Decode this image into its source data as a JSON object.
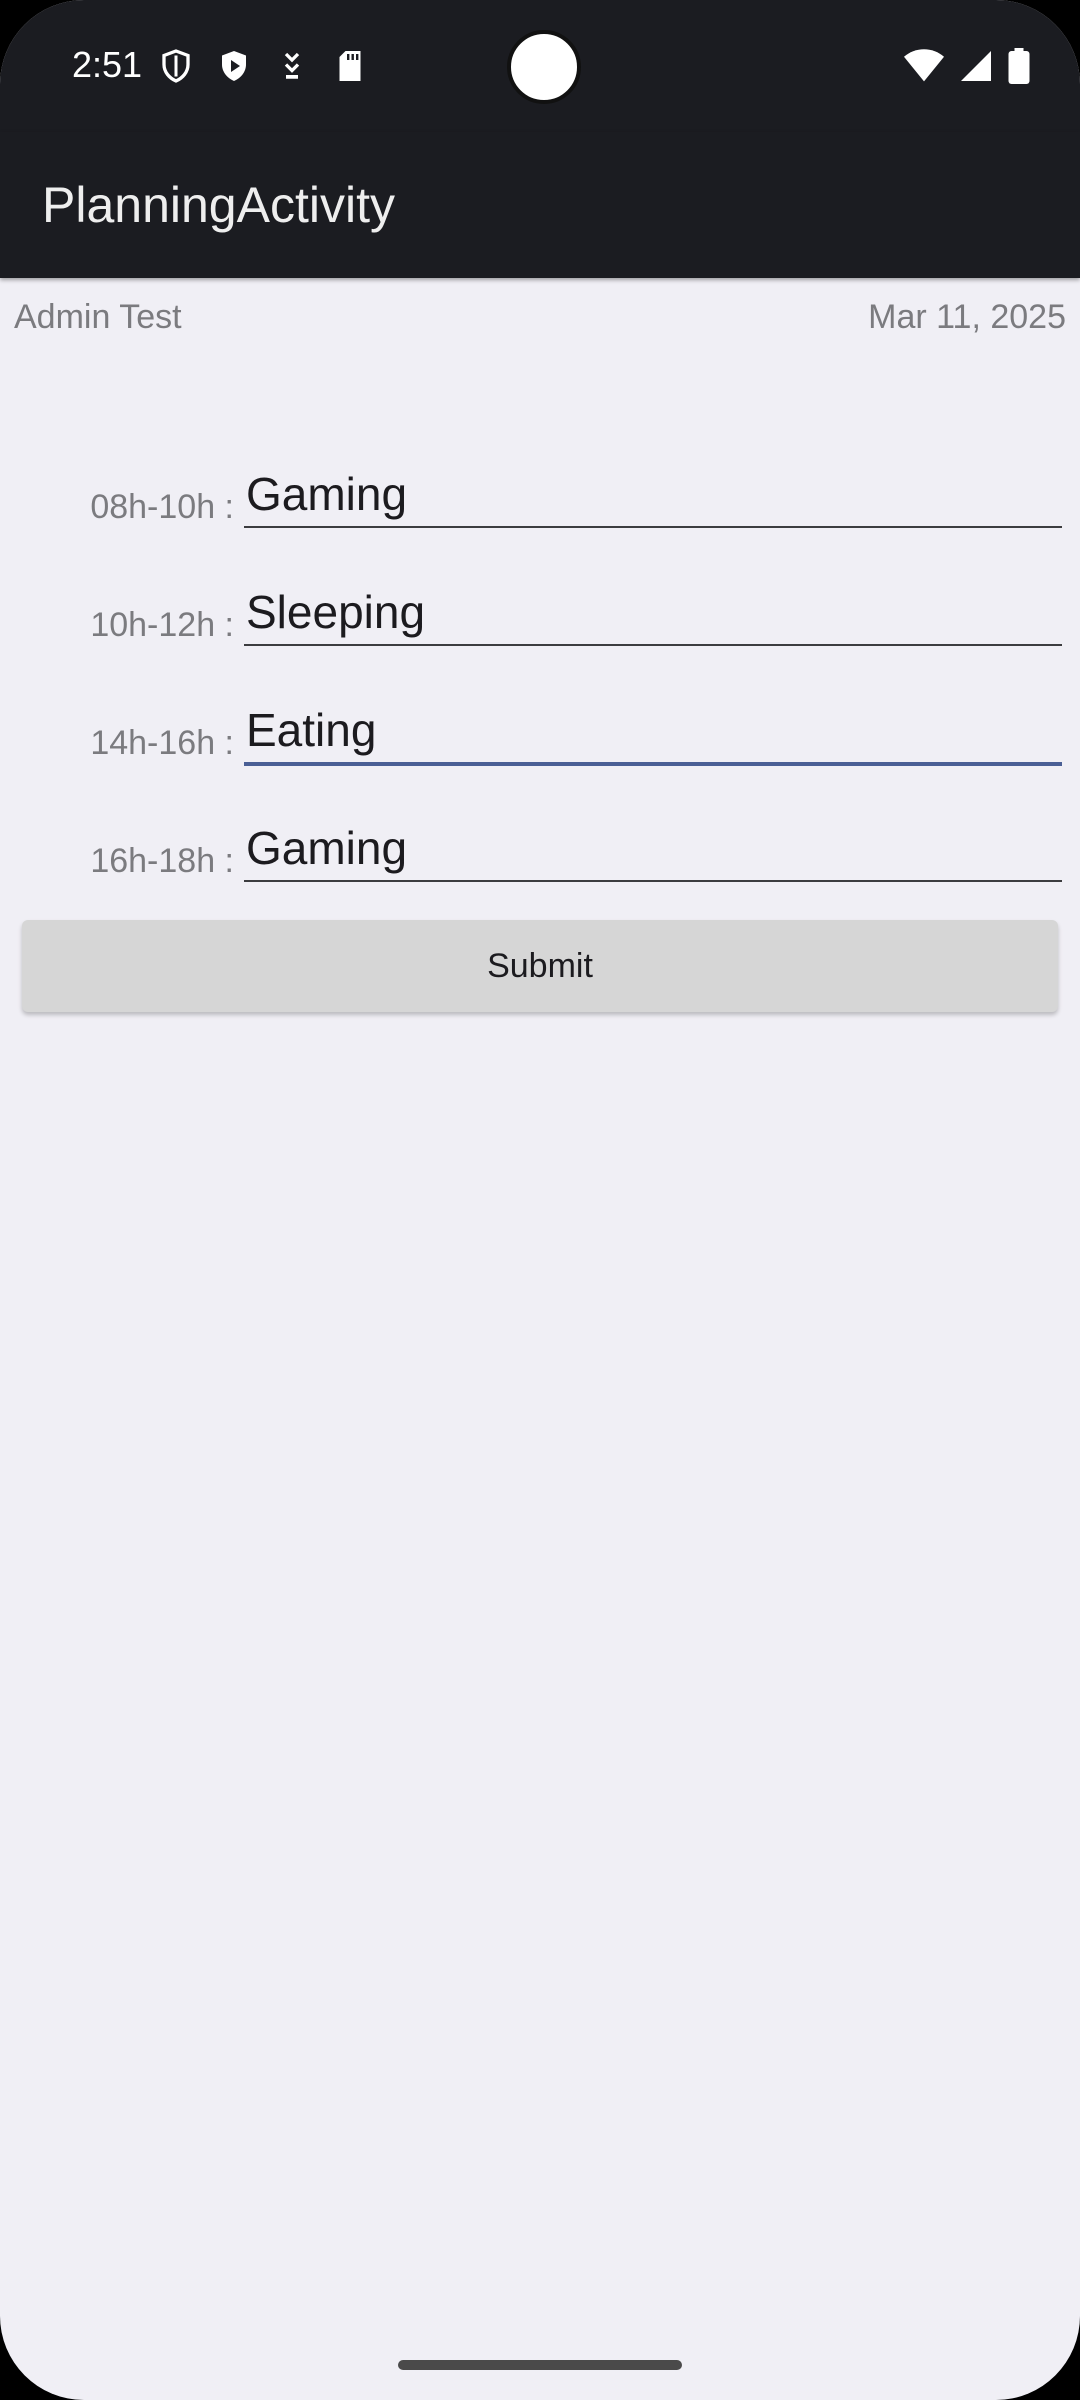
{
  "status_bar": {
    "time": "2:51",
    "icons_left": [
      "shield-icon",
      "play-protect-icon",
      "download-icon",
      "sd-card-icon"
    ],
    "icons_right": [
      "wifi-icon",
      "cell-signal-icon",
      "battery-icon"
    ]
  },
  "app_bar": {
    "title": "PlanningActivity"
  },
  "meta": {
    "user": "Admin Test",
    "date": "Mar 11, 2025"
  },
  "plan": {
    "rows": [
      {
        "label": "08h-10h :",
        "value": "Gaming"
      },
      {
        "label": "10h-12h :",
        "value": "Sleeping"
      },
      {
        "label": "14h-16h :",
        "value": "Eating"
      },
      {
        "label": "16h-18h :",
        "value": "Gaming"
      }
    ],
    "focused_row_index": 2
  },
  "submit": {
    "label": "Submit"
  },
  "colors": {
    "app_bar_bg": "#1b1c21",
    "background": "#f0eff5",
    "focus_accent": "#4a5f95",
    "button_bg": "#d6d6d6"
  }
}
